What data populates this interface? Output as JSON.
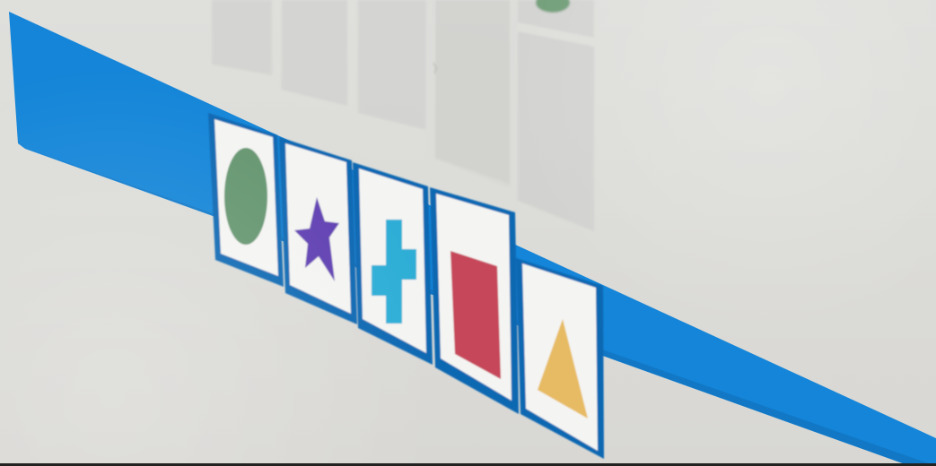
{
  "board": {
    "accent": "#1485d8",
    "border_color": "#0f68b2",
    "grid_color": "#d1d1cf"
  },
  "palette": {
    "items": [
      {
        "shape": "circle-icon",
        "color": "#659670"
      },
      {
        "shape": "star-icon",
        "color": "#6140b2"
      },
      {
        "shape": "plus-icon",
        "color": "#2eaed6"
      },
      {
        "shape": "rectangle-icon",
        "color": "#c6475a"
      },
      {
        "shape": "triangle-icon",
        "color": "#e7bb63"
      }
    ]
  },
  "grid": {
    "columns": 5,
    "rows": 3,
    "visible_piece": {
      "shape": "circle-icon",
      "color": "#659670"
    }
  }
}
